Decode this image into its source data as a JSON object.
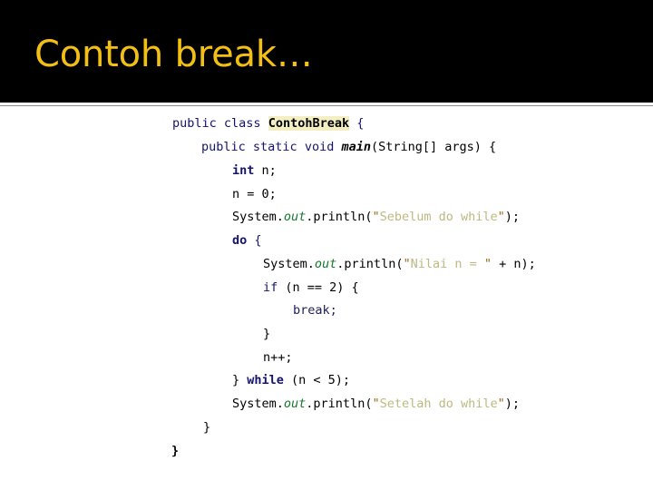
{
  "slide": {
    "title": "Contoh break…",
    "title_color": "#F2BF15",
    "header_background": "#000000",
    "body_background": "#FFFFFF",
    "rule_color": "#8C8C8C"
  },
  "code": {
    "language": "java",
    "highlight_color": "#F4EFC3",
    "colors": {
      "keyword": "#14146E",
      "field": "#13792B",
      "string": "#BDB981",
      "quote": "#9C6B1C",
      "plain": "#000000"
    },
    "lines": [
      {
        "indent": 0,
        "text": "public class ContohBreak {"
      },
      {
        "indent": 1,
        "text": "public static void main(String[] args) {"
      },
      {
        "indent": 2,
        "text": "int n;"
      },
      {
        "indent": 2,
        "text": "n = 0;"
      },
      {
        "indent": 2,
        "text": "System.out.println(\"Sebelum do while\");"
      },
      {
        "indent": 2,
        "text": "do {"
      },
      {
        "indent": 3,
        "text": "System.out.println(\"Nilai n = \" + n);"
      },
      {
        "indent": 3,
        "text": "if (n == 2) {"
      },
      {
        "indent": 4,
        "text": "break;"
      },
      {
        "indent": 3,
        "text": "}"
      },
      {
        "indent": 3,
        "text": "n++;"
      },
      {
        "indent": 2,
        "text": "} while (n < 5);"
      },
      {
        "indent": 2,
        "text": "System.out.println(\"Setelah do while\");"
      },
      {
        "indent": 1,
        "text": "}"
      },
      {
        "indent": 0,
        "text": "}"
      }
    ],
    "tokens": {
      "l1_kw1": "public",
      "l1_kw2": "class",
      "l1_name": "ContohBreak",
      "l1_brace": "{",
      "l2_kw1": "public",
      "l2_kw2": "static",
      "l2_kw3": "void",
      "l2_main": "main",
      "l2_rest": "(String[] args) {",
      "l3_kw": "int",
      "l3_rest": "n;",
      "l4": "n = 0;",
      "l5_a": "System.",
      "l5_field": "out",
      "l5_b": ".println(",
      "l5_q1": "\"",
      "l5_str": "Sebelum do while",
      "l5_q2": "\"",
      "l5_c": ");",
      "l6_kw": "do",
      "l6_rest": " {",
      "l7_a": "System.",
      "l7_field": "out",
      "l7_b": ".println(",
      "l7_q1": "\"",
      "l7_str": "Nilai n = ",
      "l7_q2": "\"",
      "l7_c": " + n);",
      "l8_kw": "if",
      "l8_rest": " (n == 2) {",
      "l9_kw": "break;",
      "l10": "}",
      "l11": "n++;",
      "l12_a": "} ",
      "l12_kw": "while",
      "l12_b": " (n < 5);",
      "l13_a": "System.",
      "l13_field": "out",
      "l13_b": ".println(",
      "l13_q1": "\"",
      "l13_str": "Setelah do while",
      "l13_q2": "\"",
      "l13_c": ");",
      "l14": "}",
      "l15": "}"
    }
  }
}
